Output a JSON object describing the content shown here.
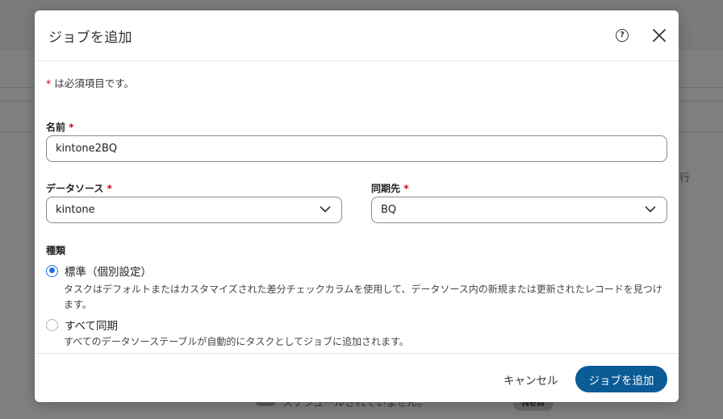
{
  "background": {
    "side_text": "行",
    "bottom_text": "スケジュールされていません。",
    "pill_text": "New"
  },
  "modal": {
    "title": "ジョブを追加",
    "help_icon": "help-circle-icon",
    "close_icon": "close-icon",
    "required_note": "は必須項目です。",
    "required_mark": "*",
    "name": {
      "label": "名前",
      "value": "kintone2BQ"
    },
    "data_source": {
      "label": "データソース",
      "value": "kintone"
    },
    "destination": {
      "label": "同期先",
      "value": "BQ"
    },
    "type": {
      "label": "種類",
      "options": [
        {
          "label": "標準（個別設定）",
          "description": "タスクはデフォルトまたはカスタマイズされた差分チェックカラムを使用して、データソース内の新規または更新されたレコードを見つけます。",
          "selected": true
        },
        {
          "label": "すべて同期",
          "description": "すべてのデータソーステーブルが自動的にタスクとしてジョブに追加されます。",
          "selected": false
        }
      ]
    },
    "footer": {
      "cancel_label": "キャンセル",
      "submit_label": "ジョブを追加"
    }
  },
  "colors": {
    "primary": "#0b5b97",
    "radio_selected": "#1a73e8",
    "required": "#d0021b"
  }
}
